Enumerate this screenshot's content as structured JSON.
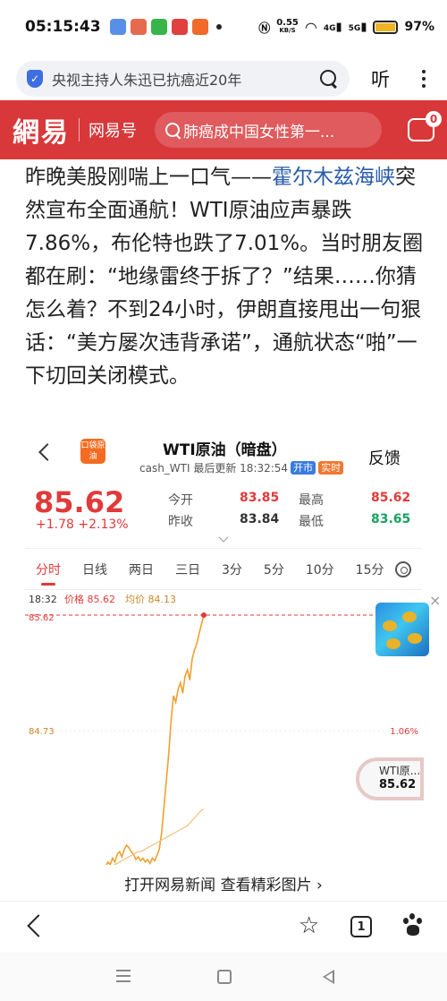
{
  "status_bar": {
    "time": "05:15:43",
    "net_speed_value": "0.55",
    "net_speed_unit": "KB/S",
    "signal_label_1": "4G",
    "signal_label_2": "5G",
    "battery_text": "97%",
    "battery_level": 0.97
  },
  "browser": {
    "search_text": "央视主持人朱迅已抗癌近20年",
    "listen_label": "听"
  },
  "netease": {
    "logo": "網易",
    "channel": "网易号",
    "search_text": "肺癌成中国女性第一...",
    "msg_badge": "0"
  },
  "article": {
    "text_before_link": "昨晚美股刚喘上一口气——",
    "link_text": "霍尔木兹海峡",
    "text_after_link": "突然宣布全面通航！WTI原油应声暴跌7.86%，布伦特也跌了7.01%。当时朋友圈都在刷：“地缘雷终于拆了？”结果……你猜怎么着？不到24小时，伊朗直接甩出一句狠话：“美方屡次违背承诺”，通航状态“啪”一下切回关闭模式。"
  },
  "quote": {
    "logo_text": "口袋原油",
    "title": "WTI原油（暗盘）",
    "subtitle": "cash_WTI 最后更新 18:32:54",
    "tag_open": "开市",
    "tag_realtime": "实时",
    "feedback": "反馈",
    "price": "85.62",
    "change": "+1.78 +2.13%",
    "stats": {
      "open_label": "今开",
      "open_value": "83.85",
      "high_label": "最高",
      "high_value": "85.62",
      "prev_label": "昨收",
      "prev_value": "83.84",
      "low_label": "最低",
      "low_value": "83.65"
    },
    "tabs": [
      "分时",
      "日线",
      "两日",
      "三日",
      "3分",
      "5分",
      "10分",
      "15分"
    ],
    "active_tab": "分时",
    "colors": {
      "up": "#e03a3a",
      "down": "#1aa260",
      "line": "#f0a030",
      "avg": "#f0c080"
    }
  },
  "chart_data": {
    "type": "line",
    "legend": {
      "time": "18:32",
      "price": "价格 85.62",
      "avg": "均价 84.13"
    },
    "y_tick_labels": [
      "85.62",
      "84.73"
    ],
    "right_labels": [
      "1.06%"
    ],
    "ylim": [
      83.65,
      85.62
    ],
    "series": [
      {
        "values": [
          83.68,
          83.72,
          83.7,
          83.75,
          83.72,
          83.78,
          83.8,
          83.76,
          83.82,
          83.85,
          83.83,
          83.8,
          83.78,
          83.74,
          83.76,
          83.73,
          83.75,
          83.72,
          83.74,
          83.71,
          83.75,
          83.73,
          83.77,
          83.82,
          83.95,
          84.15,
          84.35,
          84.55,
          84.8,
          85.0,
          84.95,
          85.05,
          85.1,
          85.02,
          85.15,
          85.2,
          85.12,
          85.28,
          85.35,
          85.4,
          85.48,
          85.55,
          85.62
        ]
      },
      {
        "values": [
          83.66,
          83.67,
          83.68,
          83.69,
          83.7,
          83.71,
          83.72,
          83.73,
          83.74,
          83.75,
          83.76,
          83.77,
          83.78,
          83.79,
          83.8,
          83.8,
          83.81,
          83.82,
          83.83,
          83.84,
          83.85,
          83.86,
          83.87,
          83.88,
          83.89,
          83.9,
          83.91,
          83.92,
          83.93,
          83.94,
          83.95,
          83.96,
          83.97,
          83.98,
          83.99,
          84.0,
          84.02,
          84.04,
          84.06,
          84.08,
          84.1,
          84.12,
          84.13
        ]
      }
    ]
  },
  "overlay": {
    "close_glyph": "×",
    "float_name": "WTI原...",
    "float_price": "85.62",
    "open_app_text": "打开网易新闻 查看精彩图片 ›"
  },
  "bottom_bar": {
    "tab_count": "1",
    "star_glyph": "☆"
  }
}
